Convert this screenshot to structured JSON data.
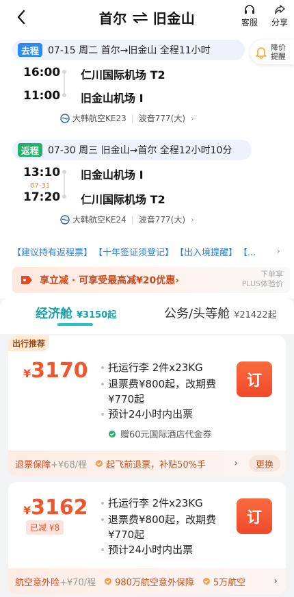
{
  "header": {
    "from": "首尔",
    "to": "旧金山",
    "kefu_label": "客服",
    "share_label": "分享"
  },
  "price_alert": {
    "label": "降价提醒"
  },
  "outbound": {
    "tag": "去程",
    "summary": "07-15 周二  首尔→旧金山  全程11小时",
    "dep_time": "16:00",
    "dep_airport": "仁川国际机场 T2",
    "arr_time": "11:00",
    "arr_airport": "旧金山机场 I",
    "airline": "大韩航空KE23",
    "aircraft": "波音777(大)"
  },
  "return": {
    "tag": "返程",
    "summary": "07-30 周三  旧金山→首尔  全程12小时10分",
    "dep_time": "13:10",
    "dep_airport": "旧金山机场 I",
    "next_day": "07-31",
    "arr_time": "17:20",
    "arr_airport": "仁川国际机场 T2",
    "airline": "大韩航空KE24",
    "aircraft": "波音777(大)"
  },
  "notices": [
    "【建议持有返程票】",
    "【十年签证须登记】",
    "【出入境提醒】",
    "【..."
  ],
  "promo": {
    "text": "享立减 · 可享受最高减¥20优惠›",
    "plus_line1": "下单享",
    "plus_line2": "PLUS体验价"
  },
  "cabins": {
    "economy_label": "经济舱",
    "economy_price": "¥3150起",
    "business_label": "公务/头等舱",
    "business_price": "¥21422起"
  },
  "offers": [
    {
      "badge": "出行推荐",
      "currency": "¥",
      "price": "3170",
      "baggage": "托运行李 2件x23KG",
      "refund_line1": "退票费¥800起，改期费",
      "refund_line2": "¥770起",
      "ticketing": "预计24小时内出票",
      "coupon": "赠60元国际酒店代金券",
      "book_label": "订",
      "foot_label": "退票保障",
      "foot_price": "+¥68/程",
      "foot_guarantee": "起飞前退票，补贴50%手",
      "change_label": "更换"
    },
    {
      "currency": "¥",
      "price": "3162",
      "reduced": "已减 ¥8",
      "baggage": "托运行李 2件x23KG",
      "refund_line1": "退票费¥800起，改期费",
      "refund_line2": "¥770起",
      "ticketing": "预计24小时内出票",
      "book_label": "订",
      "foot_label": "航空意外险",
      "foot_price": "+¥70/程",
      "foot_guarantee": "980万航空意外保障",
      "foot_guarantee2": "5万航空"
    }
  ]
}
